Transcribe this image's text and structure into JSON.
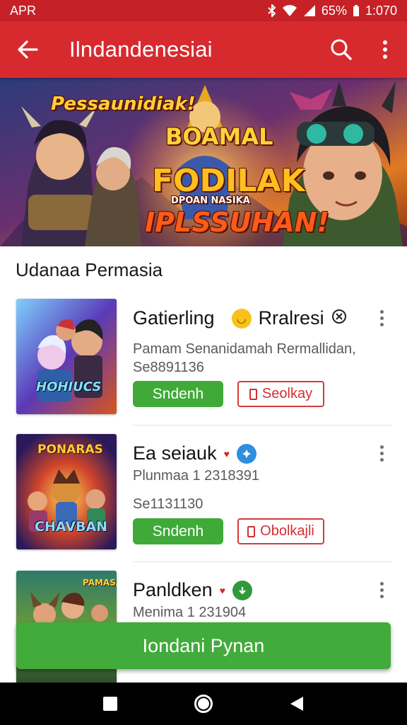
{
  "status_bar": {
    "carrier": "APR",
    "battery": "65%",
    "time": "1:070",
    "icons": [
      "bluetooth-icon",
      "wifi-icon",
      "signal-icon"
    ]
  },
  "app_bar": {
    "title": "Ilndandenesiai",
    "icons": [
      "back-arrow-icon",
      "search-icon",
      "more-vert-icon"
    ],
    "color": "#d72a2f"
  },
  "banner": {
    "text_top": "Pessaunidiak!",
    "text_mid1": "BOAMAL",
    "text_mid2": "FODILAK",
    "text_small": "DPOAN NASIKA",
    "text_bottom": "IPLSSUHAN!"
  },
  "section": {
    "title": "Udanaa Permasia"
  },
  "items": [
    {
      "name": "Gatierling",
      "tag": "Rralresi",
      "thumb_caption": "HOHIUCS",
      "line1": "Pamam Senanidamah Rermallidan,",
      "line2": "Se8891136",
      "primary_button": "Sndenh",
      "secondary_button": "Seolkay"
    },
    {
      "name": "Ea seiauk",
      "thumb_caption_top": "PONARAS",
      "thumb_caption": "CHAVBAN",
      "line1": "Plunmaa 1 2318391",
      "line2": "Se1131130",
      "primary_button": "Sndenh",
      "secondary_button": "Obolkajli"
    },
    {
      "name": "Panldken",
      "thumb_caption": "PAMASAB",
      "line1": "Menima 1 231904"
    }
  ],
  "fab": {
    "label": "Iondani Pynan",
    "color": "#41ab3b"
  },
  "nav_bar": {
    "icons": [
      "recent-apps-icon",
      "home-icon",
      "back-icon"
    ]
  }
}
